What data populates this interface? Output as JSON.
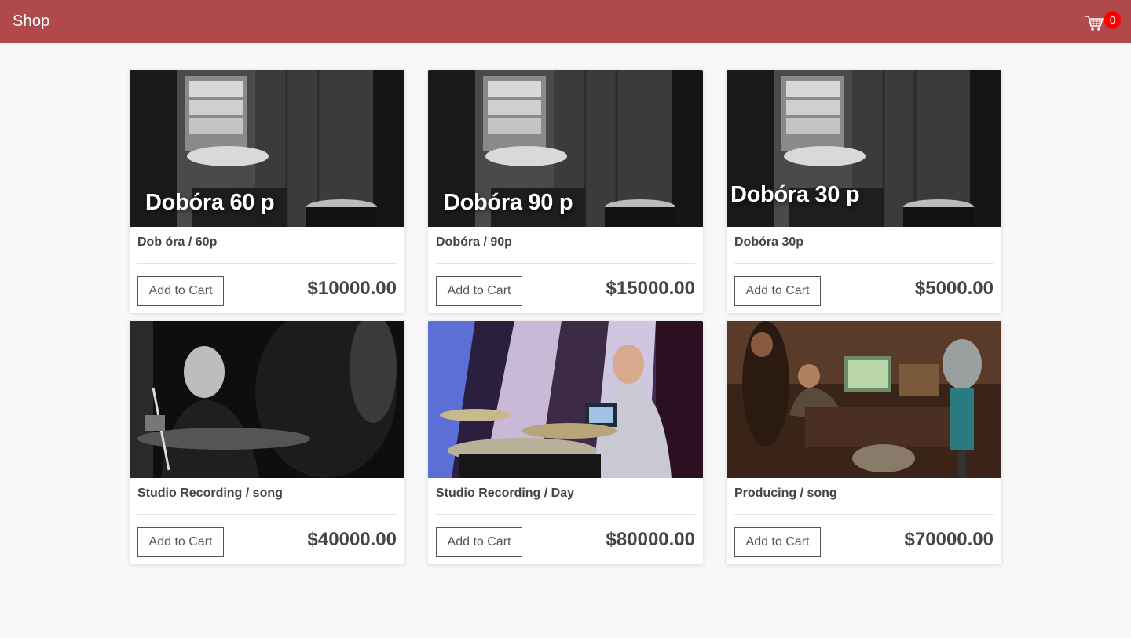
{
  "nav": {
    "brand": "Shop",
    "cart_icon": "shopping-cart-icon",
    "cart_count": "0",
    "colors": {
      "bar": "#b0494b",
      "badge": "#ff0000"
    }
  },
  "products": [
    {
      "title": "Dob óra / 60p",
      "price": "$10000.00",
      "button": "Add to Cart",
      "image_text": "Dobóra 60 p",
      "image": "drum-room-bw"
    },
    {
      "title": "Dobóra / 90p",
      "price": "$15000.00",
      "button": "Add to Cart",
      "image_text": "Dobóra 90 p",
      "image": "drum-room-bw"
    },
    {
      "title": "Dobóra 30p",
      "price": "$5000.00",
      "button": "Add to Cart",
      "image_text": "Dobóra 30 p",
      "image": "drum-room-bw"
    },
    {
      "title": "Studio Recording / song",
      "price": "$40000.00",
      "button": "Add to Cart",
      "image_text": "",
      "image": "drummer-bw"
    },
    {
      "title": "Studio Recording / Day",
      "price": "$80000.00",
      "button": "Add to Cart",
      "image_text": "",
      "image": "drummer-studio-color"
    },
    {
      "title": "Producing / song",
      "price": "$70000.00",
      "button": "Add to Cart",
      "image_text": "",
      "image": "recording-studio-mic"
    }
  ]
}
